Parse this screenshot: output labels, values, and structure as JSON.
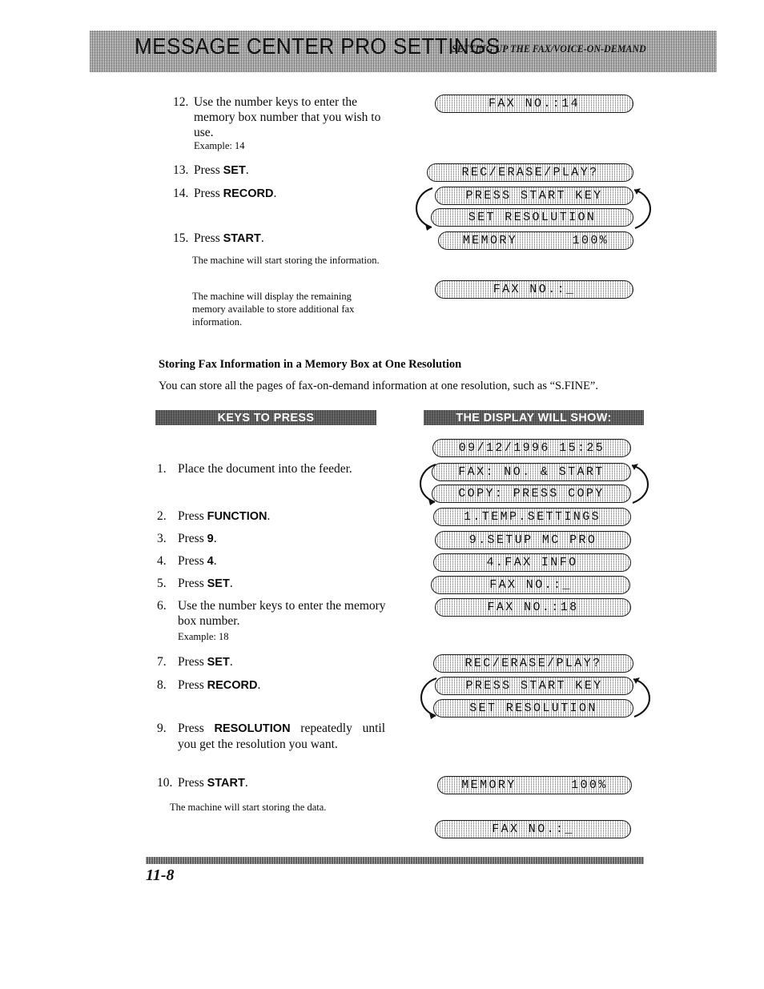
{
  "header": {
    "title": "MESSAGE CENTER PRO SETTINGS",
    "subtitle": "SETTING UP THE FAX/VOICE-ON-DEMAND"
  },
  "section_top": {
    "steps": [
      {
        "num": "12.",
        "text": "Use the number keys to enter the memory box number that you wish to use."
      },
      {
        "num": "13.",
        "text_pre": "Press ",
        "bold": "SET",
        "text_post": "."
      },
      {
        "num": "14.",
        "text_pre": "Press ",
        "bold": "RECORD",
        "text_post": "."
      },
      {
        "num": "15.",
        "text_pre": "Press ",
        "bold": "START",
        "text_post": "."
      }
    ],
    "example": "Example: 14",
    "note1": "The machine will start storing the information.",
    "note2": "The machine will display the remaining memory available to store additional fax information.",
    "displays": {
      "fax_no_14": "FAX NO.:14",
      "rec_erase_play": "REC/ERASE/PLAY?",
      "press_start_key": "PRESS START KEY",
      "set_resolution": "SET RESOLUTION",
      "memory": "MEMORY      100%",
      "fax_no_blank": "FAX NO.:_"
    }
  },
  "section_bottom": {
    "heading": "Storing Fax Information in a Memory Box at One Resolution",
    "description": "You can store all the pages of fax-on-demand information at one resolution, such as “S.FINE”.",
    "bars": {
      "keys": "KEYS TO PRESS",
      "display": "THE DISPLAY WILL SHOW:"
    },
    "steps": [
      {
        "num": "1.",
        "text": "Place the document into the feeder."
      },
      {
        "num": "2.",
        "text_pre": "Press ",
        "bold": "FUNCTION",
        "text_post": "."
      },
      {
        "num": "3.",
        "text_pre": "Press ",
        "bold": "9",
        "text_post": "."
      },
      {
        "num": "4.",
        "text_pre": "Press ",
        "bold": "4",
        "text_post": "."
      },
      {
        "num": "5.",
        "text_pre": "Press ",
        "bold": "SET",
        "text_post": "."
      },
      {
        "num": "6.",
        "text": "Use the number keys to enter the memory box number."
      },
      {
        "num": "7.",
        "text_pre": "Press ",
        "bold": "SET",
        "text_post": "."
      },
      {
        "num": "8.",
        "text_pre": "Press ",
        "bold": "RECORD",
        "text_post": "."
      },
      {
        "num": "9.",
        "text_pre": "Press ",
        "bold": "RESOLUTION",
        "text_post": " repeatedly until you get the resolution you want."
      },
      {
        "num": "10.",
        "text_pre": "Press ",
        "bold": "START",
        "text_post": "."
      }
    ],
    "example": "Example: 18",
    "note": "The machine will start storing the data.",
    "displays": {
      "datetime": "09/12/1996 15:25",
      "fax_no_start": "FAX: NO. & START",
      "copy_press_copy": "COPY: PRESS COPY",
      "temp_settings": "1.TEMP.SETTINGS",
      "setup_mc_pro": "9.SETUP MC PRO",
      "fax_info": "4.FAX INFO",
      "fax_no_blank1": "FAX NO.:_",
      "fax_no_18": "FAX NO.:18",
      "rec_erase_play": "REC/ERASE/PLAY?",
      "press_start_key": "PRESS START KEY",
      "set_resolution": "SET RESOLUTION",
      "memory": "MEMORY      100%",
      "fax_no_blank2": "FAX NO.:_"
    }
  },
  "footer": {
    "page_number": "11-8"
  },
  "colors": {
    "ink": "#0a0a0a",
    "band_light": "#d8d8d8",
    "band_dark": "#3b3b3b",
    "lcd_face": "#d5d5d5"
  }
}
